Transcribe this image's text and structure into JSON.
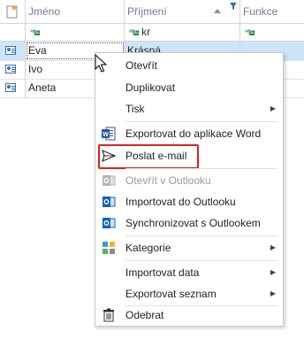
{
  "grid": {
    "columns": [
      "Jméno",
      "Příjmení",
      "Funkce"
    ],
    "filter": {
      "surname_value": "kr",
      "filter_badge": "ABC"
    },
    "rows": [
      {
        "first": "Eva",
        "last": "Krásná"
      },
      {
        "first": "Ivo",
        "last": ""
      },
      {
        "first": "Aneta",
        "last": ""
      }
    ]
  },
  "menu": {
    "items": {
      "open": "Otevřít",
      "duplicate": "Duplikovat",
      "print": "Tisk",
      "export_word": "Exportovat do aplikace Word",
      "send_email": "Poslat e-mail",
      "open_outlook": "Otevřít v Outlooku",
      "import_outlook": "Importovat do Outlooku",
      "sync_outlook": "Synchronizovat s Outlookem",
      "categories": "Kategorie",
      "import_data": "Importovat data",
      "export_list": "Exportovat seznam",
      "remove": "Odebrat"
    },
    "highlight_color": "#e02020"
  },
  "icons": [
    "new-record-icon",
    "sort-ascending-icon",
    "filter-icon",
    "contact-card-icon",
    "word-icon",
    "send-icon",
    "outlook-icon",
    "categories-icon",
    "trash-icon",
    "submenu-arrow-icon",
    "mouse-cursor-icon"
  ]
}
